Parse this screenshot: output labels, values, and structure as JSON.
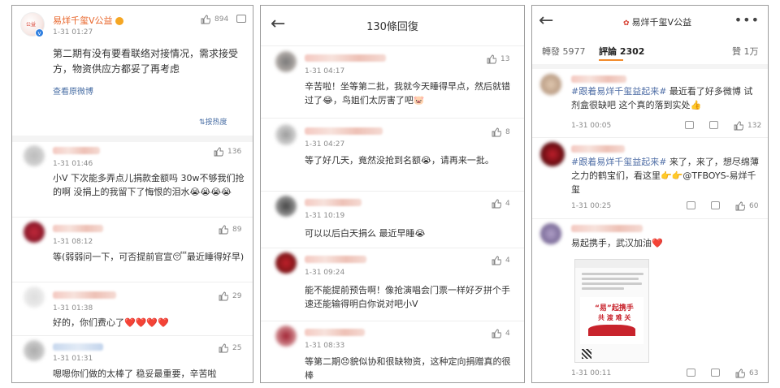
{
  "panel1": {
    "author": "易烊千玺V公益",
    "author_time": "1-31 01:27",
    "author_likes": "894",
    "post_text": "第二期有没有要看联络对接情况，需求接受方，物资供应方都妥了再考虑",
    "view_original": "查看原微博",
    "sort_label": "按热度",
    "comments": [
      {
        "time": "1-31 01:46",
        "likes": "136",
        "text": "小V 下次能多弄点儿捐款金额吗 30w不够我们抢的啊  没捐上的我留下了悔恨的泪水😭😭😭😭"
      },
      {
        "time": "1-31 08:12",
        "likes": "89",
        "text": "等(弱弱问一下，可否提前官宣😴最近睡得好早)"
      },
      {
        "time": "1-31 01:38",
        "likes": "29",
        "text": "好的，你们费心了❤️❤️❤️❤️"
      },
      {
        "time": "1-31 01:31",
        "likes": "25",
        "text": "嗯嗯你们做的太棒了 稳妥最重要，辛苦啦"
      }
    ]
  },
  "panel2": {
    "title": "130條回復",
    "replies": [
      {
        "time": "1-31 04:17",
        "likes": "13",
        "text": "辛苦啦！坐等第二批，我就今天睡得早点，然后就错过了😂，鸟姐们太厉害了吧🐷"
      },
      {
        "time": "1-31 04:27",
        "likes": "8",
        "text": "等了好几天，竟然没抢到名额😭，请再来一批。"
      },
      {
        "time": "1-31 10:19",
        "likes": "4",
        "text": "可以以后白天捐么 最近早睡😭"
      },
      {
        "time": "1-31 09:24",
        "likes": "4",
        "text": "能不能提前预告啊！像抢演唱会门票一样好歹拼个手速还能输得明白你说对吧小V"
      },
      {
        "time": "1-31 08:33",
        "likes": "4",
        "text": "等第二期😞貌似协和很缺物资，这种定向捐赠真的很棒"
      }
    ]
  },
  "panel3": {
    "title": "易烊千玺V公益",
    "tab_repost": "轉發 5977",
    "tab_comment": "評論 2302",
    "tab_like": "贊 1万",
    "comments": [
      {
        "time": "1-31 00:05",
        "likes": "132",
        "tag": "#跟着易烊千玺益起来#",
        "text": " 最近看了好多微博 试剂盒很缺吧  这个真的落到实处👍"
      },
      {
        "time": "1-31 00:25",
        "likes": "60",
        "tag": "#跟着易烊千玺益起来#",
        "text": " 来了，来了，想尽绵薄之力的鹤宝们，看这里👉👉@TFBOYS-易烊千玺"
      },
      {
        "time": "1-31 00:11",
        "likes": "63",
        "tag": "",
        "text": "易起携手，武汉加油❤️"
      }
    ],
    "poster_line1": "“易”起携手",
    "poster_line2": "共 渡 难 关"
  },
  "colors": {
    "accent": "#f28a2a",
    "link": "#4f6ea6",
    "author": "#e8652a"
  }
}
